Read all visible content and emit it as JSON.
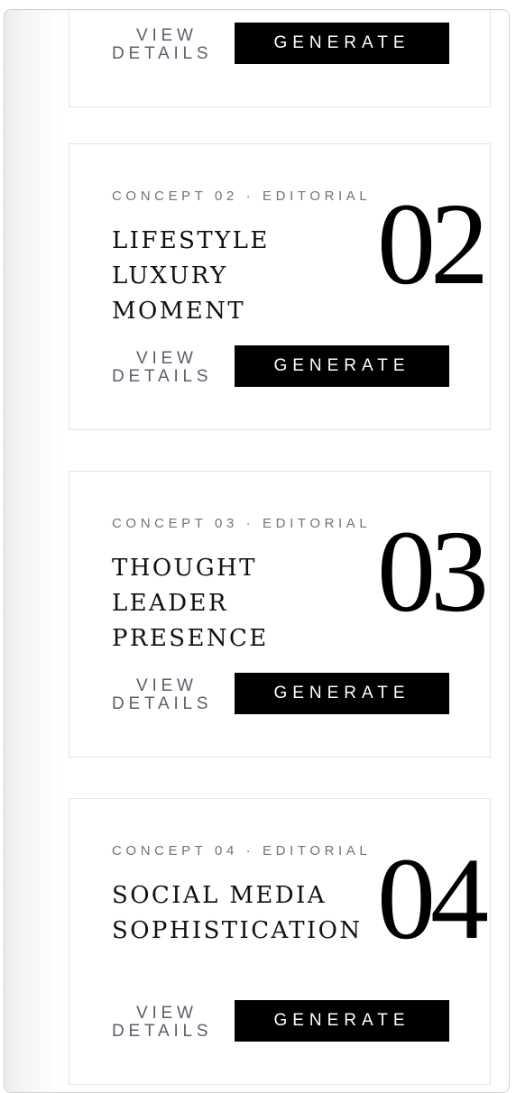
{
  "cards": [
    {
      "view_line1": "VIEW",
      "view_line2": "DETAILS",
      "generate_label": "GENERATE"
    },
    {
      "eyebrow": "CONCEPT 02 · EDITORIAL",
      "title_line1": "LIFESTYLE LUXURY",
      "title_line2": "MOMENT",
      "number": "02",
      "view_line1": "VIEW",
      "view_line2": "DETAILS",
      "generate_label": "GENERATE"
    },
    {
      "eyebrow": "CONCEPT 03 · EDITORIAL",
      "title_line1": "THOUGHT LEADER",
      "title_line2": "PRESENCE",
      "number": "03",
      "view_line1": "VIEW",
      "view_line2": "DETAILS",
      "generate_label": "GENERATE"
    },
    {
      "eyebrow": "CONCEPT 04 · EDITORIAL",
      "title_line1": "SOCIAL MEDIA",
      "title_line2": "SOPHISTICATION",
      "number": "04",
      "view_line1": "VIEW",
      "view_line2": "DETAILS",
      "generate_label": "GENERATE"
    }
  ],
  "colors": {
    "button_bg": "#000000",
    "button_text": "#ffffff",
    "eyebrow_text": "#70737d",
    "link_text": "#5b5f6b",
    "card_border": "#e4e4e6"
  }
}
